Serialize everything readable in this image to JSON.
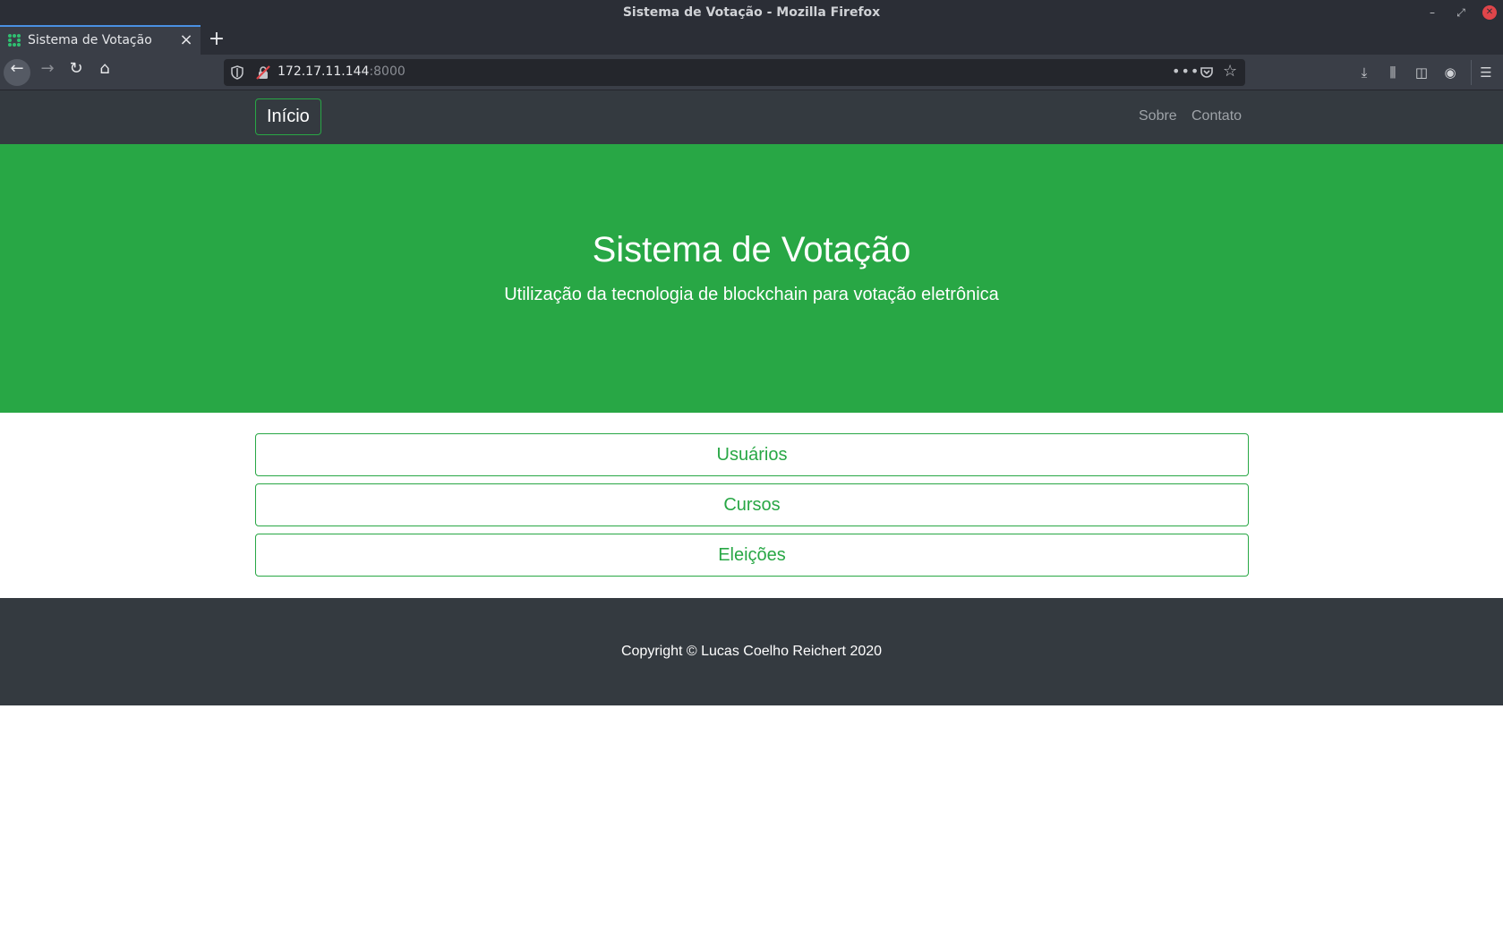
{
  "window": {
    "title": "Sistema de Votação - Mozilla Firefox",
    "minimize_glyph": "–",
    "maximize_glyph": "⤢",
    "close_glyph": "✕"
  },
  "tab": {
    "title": "Sistema de Votação",
    "close_glyph": "×",
    "new_tab_glyph": "+"
  },
  "toolbar": {
    "back_glyph": "←",
    "forward_glyph": "→",
    "reload_glyph": "↻",
    "home_glyph": "⌂",
    "url_host": "172.17.11.144",
    "url_port": ":8000",
    "page_actions_glyph": "•••",
    "bookmark_glyph": "☆",
    "downloads_glyph": "⤓",
    "library_glyph": "⫼",
    "sidebar_glyph": "◫",
    "account_glyph": "◉",
    "menu_glyph": "☰"
  },
  "navbar": {
    "brand": "Início",
    "links": [
      "Sobre",
      "Contato"
    ]
  },
  "hero": {
    "title": "Sistema de Votação",
    "subtitle": "Utilização da tecnologia de blockchain para votação eletrônica"
  },
  "menu": [
    "Usuários",
    "Cursos",
    "Eleições"
  ],
  "footer": {
    "copyright": "Copyright © Lucas Coelho Reichert 2020"
  },
  "colors": {
    "accent": "#28a745",
    "dark": "#343a40"
  }
}
